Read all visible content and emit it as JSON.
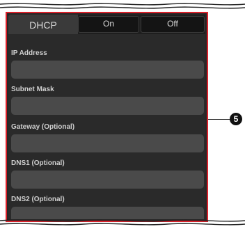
{
  "tabs": {
    "dhcp_label": "DHCP",
    "on_label": "On",
    "off_label": "Off"
  },
  "fields": [
    {
      "label": "IP Address",
      "value": ""
    },
    {
      "label": "Subnet Mask",
      "value": ""
    },
    {
      "label": "Gateway (Optional)",
      "value": ""
    },
    {
      "label": "DNS1 (Optional)",
      "value": ""
    },
    {
      "label": "DNS2 (Optional)",
      "value": ""
    }
  ],
  "callout": {
    "number": "5"
  },
  "colors": {
    "highlight_border": "#d8202a",
    "panel_bg": "#2a2a2a",
    "input_bg": "#4a4a4a"
  }
}
